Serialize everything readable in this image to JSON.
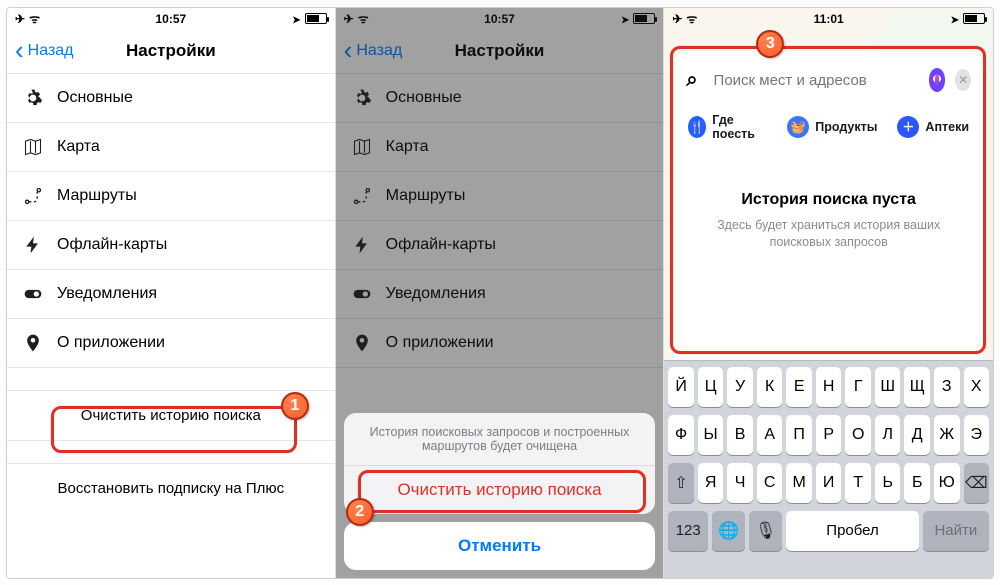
{
  "status": {
    "time1": "10:57",
    "time2": "10:57",
    "time3": "11:01"
  },
  "nav": {
    "back": "Назад",
    "title": "Настройки"
  },
  "settings_items": [
    {
      "label": "Основные"
    },
    {
      "label": "Карта"
    },
    {
      "label": "Маршруты"
    },
    {
      "label": "Офлайн-карты"
    },
    {
      "label": "Уведомления"
    },
    {
      "label": "О приложении"
    }
  ],
  "actions": {
    "clear_history": "Очистить историю поиска",
    "restore_plus": "Восстановить подписку на Плюс"
  },
  "sheet": {
    "message": "История поисковых запросов и построенных маршрутов будет очищена",
    "confirm": "Очистить историю поиска",
    "cancel": "Отменить"
  },
  "search": {
    "placeholder": "Поиск мест и адресов",
    "chip_eat": "Где поесть",
    "chip_grocery": "Продукты",
    "chip_pharm": "Аптеки",
    "empty_title": "История поиска пуста",
    "empty_sub": "Здесь будет храниться история ваших поисковых запросов"
  },
  "keyboard": {
    "row1": [
      "Й",
      "Ц",
      "У",
      "К",
      "Е",
      "Н",
      "Г",
      "Ш",
      "Щ",
      "З",
      "Х"
    ],
    "row2": [
      "Ф",
      "Ы",
      "В",
      "А",
      "П",
      "Р",
      "О",
      "Л",
      "Д",
      "Ж",
      "Э"
    ],
    "row3": [
      "Я",
      "Ч",
      "С",
      "М",
      "И",
      "Т",
      "Ь",
      "Б",
      "Ю"
    ],
    "k123": "123",
    "globe": "🌐",
    "mic": "🎙",
    "space": "Пробел",
    "find": "Найти",
    "shift": "⇧",
    "bsp": "⌫"
  },
  "badges": {
    "b1": "1",
    "b2": "2",
    "b3": "3"
  }
}
